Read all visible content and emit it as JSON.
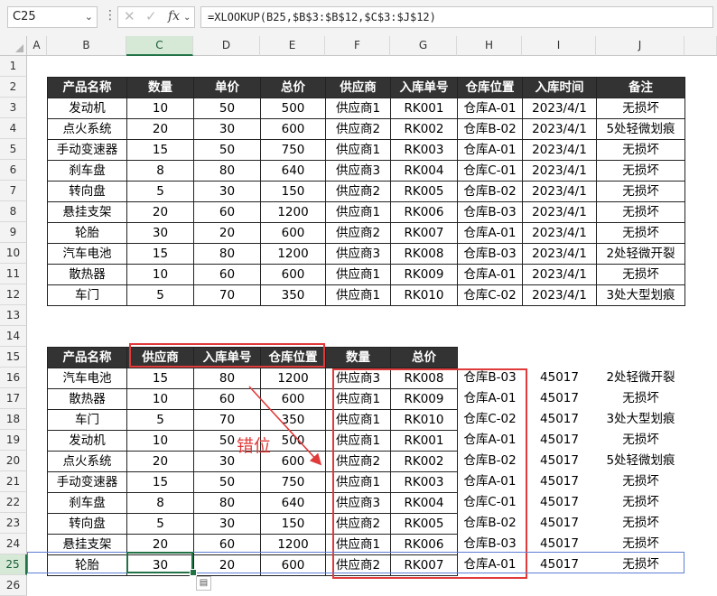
{
  "formula_bar": {
    "name_box": "C25",
    "cancel_glyph": "✕",
    "enter_glyph": "✓",
    "fx_label": "fx",
    "formula": "=XLOOKUP(B25,$B$3:$B$12,$C$3:$J$12)"
  },
  "columns": [
    "A",
    "B",
    "C",
    "D",
    "E",
    "F",
    "G",
    "H",
    "I",
    "J"
  ],
  "rows": [
    "1",
    "2",
    "3",
    "4",
    "5",
    "6",
    "7",
    "8",
    "9",
    "10",
    "11",
    "12",
    "13",
    "14",
    "15",
    "16",
    "17",
    "18",
    "19",
    "20",
    "21",
    "22",
    "23",
    "24",
    "25",
    "26"
  ],
  "table1": {
    "headers": [
      "产品名称",
      "数量",
      "单价",
      "总价",
      "供应商",
      "入库单号",
      "仓库位置",
      "入库时间",
      "备注"
    ],
    "rows": [
      [
        "发动机",
        "10",
        "50",
        "500",
        "供应商1",
        "RK001",
        "仓库A-01",
        "2023/4/1",
        "无损坏"
      ],
      [
        "点火系统",
        "20",
        "30",
        "600",
        "供应商2",
        "RK002",
        "仓库B-02",
        "2023/4/1",
        "5处轻微划痕"
      ],
      [
        "手动变速器",
        "15",
        "50",
        "750",
        "供应商1",
        "RK003",
        "仓库A-01",
        "2023/4/1",
        "无损坏"
      ],
      [
        "刹车盘",
        "8",
        "80",
        "640",
        "供应商3",
        "RK004",
        "仓库C-01",
        "2023/4/1",
        "无损坏"
      ],
      [
        "转向盘",
        "5",
        "30",
        "150",
        "供应商2",
        "RK005",
        "仓库B-02",
        "2023/4/1",
        "无损坏"
      ],
      [
        "悬挂支架",
        "20",
        "60",
        "1200",
        "供应商1",
        "RK006",
        "仓库B-03",
        "2023/4/1",
        "无损坏"
      ],
      [
        "轮胎",
        "30",
        "20",
        "600",
        "供应商2",
        "RK007",
        "仓库A-01",
        "2023/4/1",
        "无损坏"
      ],
      [
        "汽车电池",
        "15",
        "80",
        "1200",
        "供应商3",
        "RK008",
        "仓库B-03",
        "2023/4/1",
        "2处轻微开裂"
      ],
      [
        "散热器",
        "10",
        "60",
        "600",
        "供应商1",
        "RK009",
        "仓库A-01",
        "2023/4/1",
        "无损坏"
      ],
      [
        "车门",
        "5",
        "70",
        "350",
        "供应商1",
        "RK010",
        "仓库C-02",
        "2023/4/1",
        "3处大型划痕"
      ]
    ]
  },
  "table2": {
    "headers": [
      "产品名称",
      "供应商",
      "入库单号",
      "仓库位置",
      "数量",
      "总价"
    ],
    "rows": [
      [
        "汽车电池",
        "15",
        "80",
        "1200",
        "供应商3",
        "RK008",
        "仓库B-03",
        "45017",
        "2处轻微开裂"
      ],
      [
        "散热器",
        "10",
        "60",
        "600",
        "供应商1",
        "RK009",
        "仓库A-01",
        "45017",
        "无损坏"
      ],
      [
        "车门",
        "5",
        "70",
        "350",
        "供应商1",
        "RK010",
        "仓库C-02",
        "45017",
        "3处大型划痕"
      ],
      [
        "发动机",
        "10",
        "50",
        "500",
        "供应商1",
        "RK001",
        "仓库A-01",
        "45017",
        "无损坏"
      ],
      [
        "点火系统",
        "20",
        "30",
        "600",
        "供应商2",
        "RK002",
        "仓库B-02",
        "45017",
        "5处轻微划痕"
      ],
      [
        "手动变速器",
        "15",
        "50",
        "750",
        "供应商1",
        "RK003",
        "仓库A-01",
        "45017",
        "无损坏"
      ],
      [
        "刹车盘",
        "8",
        "80",
        "640",
        "供应商3",
        "RK004",
        "仓库C-01",
        "45017",
        "无损坏"
      ],
      [
        "转向盘",
        "5",
        "30",
        "150",
        "供应商2",
        "RK005",
        "仓库B-02",
        "45017",
        "无损坏"
      ],
      [
        "悬挂支架",
        "20",
        "60",
        "1200",
        "供应商1",
        "RK006",
        "仓库B-03",
        "45017",
        "无损坏"
      ],
      [
        "轮胎",
        "30",
        "20",
        "600",
        "供应商2",
        "RK007",
        "仓库A-01",
        "45017",
        "无损坏"
      ]
    ]
  },
  "annotation": {
    "label": "错位",
    "color": "#e03a3a"
  },
  "colors": {
    "header_fill": "#333333",
    "header_text": "#ffffff",
    "selection_green": "#217346"
  }
}
